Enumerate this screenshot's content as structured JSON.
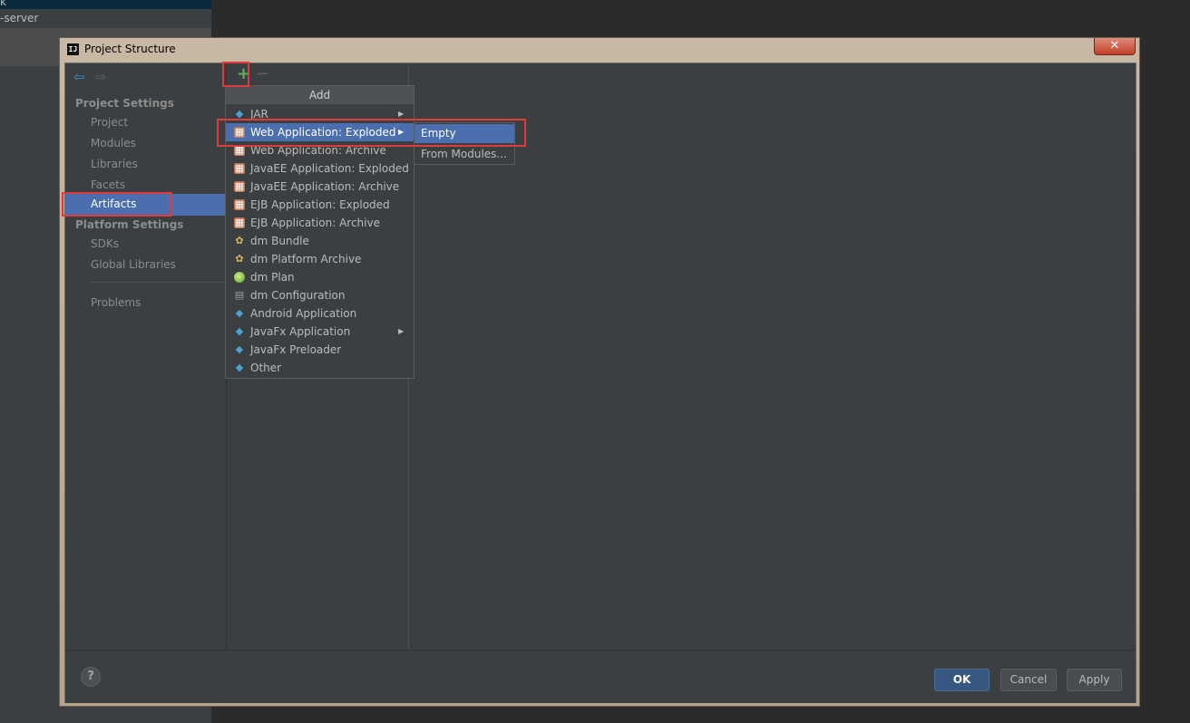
{
  "background": {
    "top_text": "k",
    "server_text": "-server"
  },
  "window": {
    "title": "Project Structure",
    "title_icon_text": "IJ",
    "close_symbol": "✕"
  },
  "sidebar": {
    "back_icon": "⇦",
    "forward_icon": "⇨",
    "project_settings_label": "Project Settings",
    "project_items": [
      "Project",
      "Modules",
      "Libraries",
      "Facets",
      "Artifacts"
    ],
    "selected_item": "Artifacts",
    "platform_settings_label": "Platform Settings",
    "platform_items": [
      "SDKs",
      "Global Libraries"
    ],
    "problems_label": "Problems"
  },
  "toolbar": {
    "add_symbol": "+",
    "remove_symbol": "−"
  },
  "add_menu": {
    "header": "Add",
    "items": [
      {
        "label": "JAR",
        "icon": "diamond-icon",
        "has_submenu": true
      },
      {
        "label": "Web Application: Exploded",
        "icon": "web-app-icon",
        "has_submenu": true,
        "highlighted": true
      },
      {
        "label": "Web Application: Archive",
        "icon": "web-app-icon"
      },
      {
        "label": "JavaEE Application: Exploded",
        "icon": "javaee-icon"
      },
      {
        "label": "JavaEE Application: Archive",
        "icon": "javaee-icon"
      },
      {
        "label": "EJB Application: Exploded",
        "icon": "ejb-icon"
      },
      {
        "label": "EJB Application: Archive",
        "icon": "ejb-icon"
      },
      {
        "label": "dm Bundle",
        "icon": "bundle-icon"
      },
      {
        "label": "dm Platform Archive",
        "icon": "bundle-icon"
      },
      {
        "label": "dm Plan",
        "icon": "plan-icon"
      },
      {
        "label": "dm Configuration",
        "icon": "config-icon"
      },
      {
        "label": "Android Application",
        "icon": "diamond-icon"
      },
      {
        "label": "JavaFx Application",
        "icon": "diamond-icon",
        "has_submenu": true
      },
      {
        "label": "JavaFx Preloader",
        "icon": "diamond-icon"
      },
      {
        "label": "Other",
        "icon": "diamond-icon"
      }
    ],
    "submenu_arrow": "▶"
  },
  "submenu": {
    "items": [
      {
        "label": "Empty",
        "highlighted": true
      },
      {
        "label": "From Modules..."
      }
    ]
  },
  "footer": {
    "help_symbol": "?",
    "ok_label": "OK",
    "cancel_label": "Cancel",
    "apply_label": "Apply"
  },
  "colors": {
    "selection": "#4b6eaf",
    "annotation_red": "#e4393c",
    "add_green": "#5fb157"
  }
}
